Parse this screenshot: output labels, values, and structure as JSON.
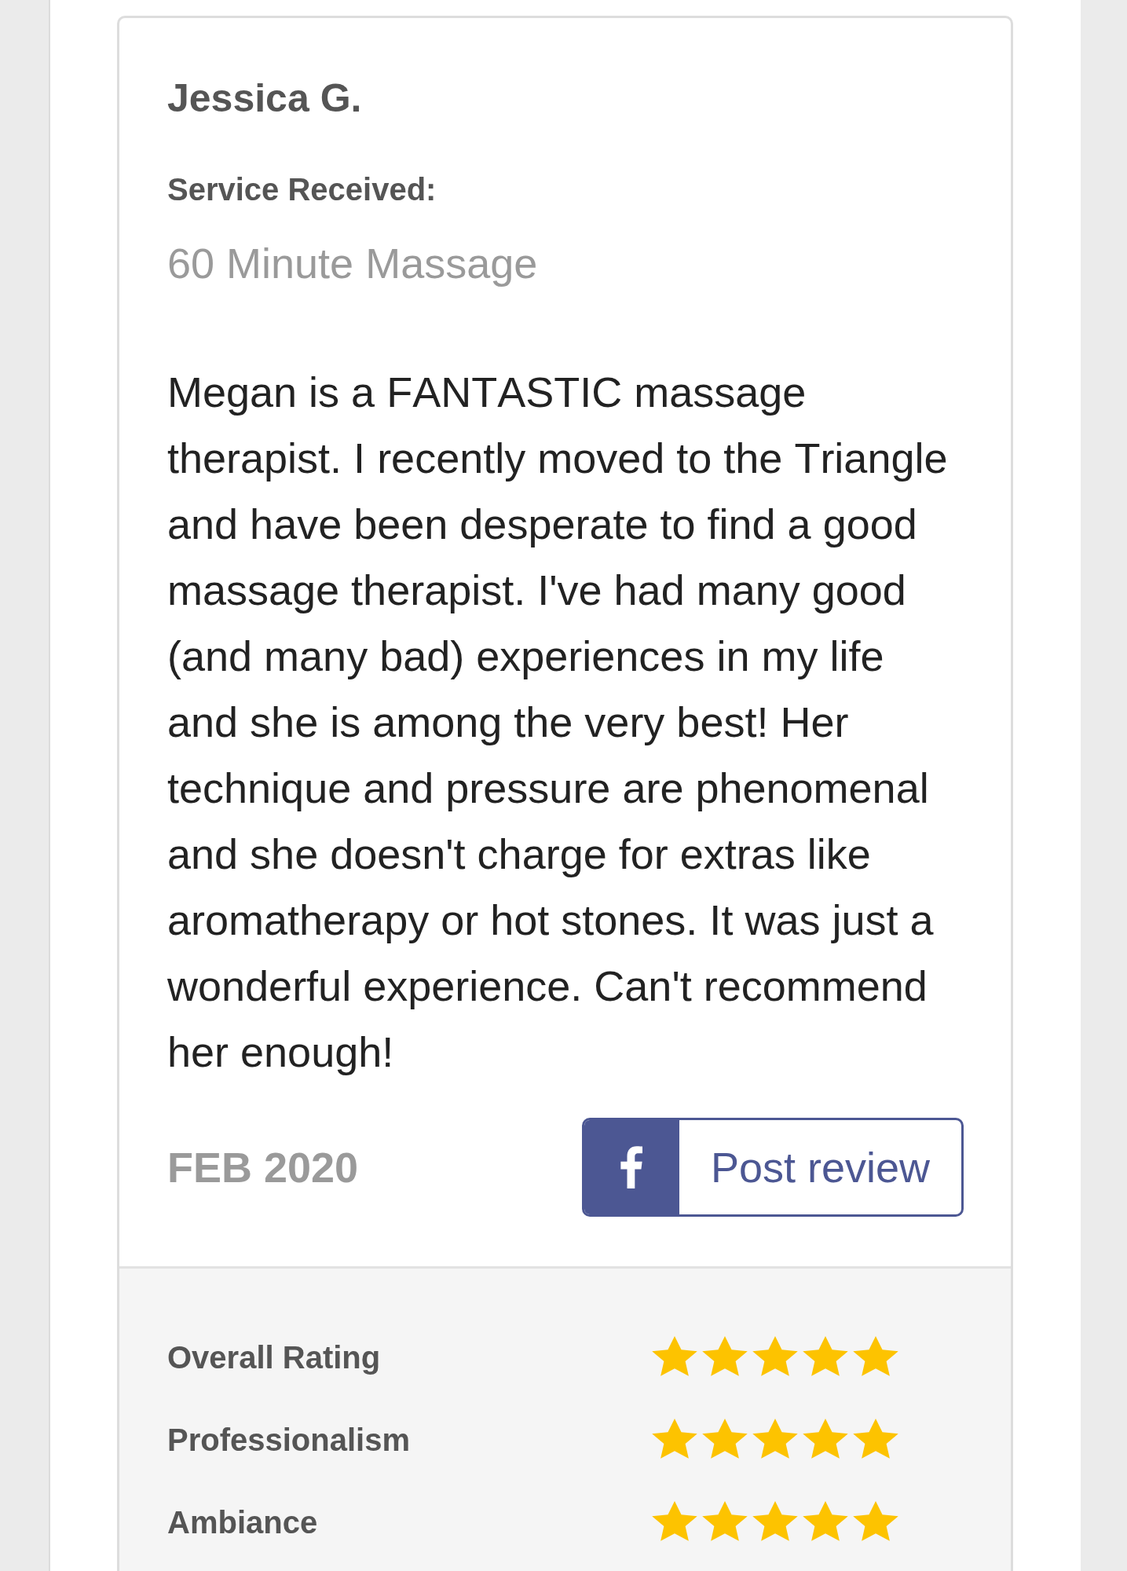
{
  "review": {
    "reviewer": "Jessica G.",
    "service_label": "Service Received:",
    "service": "60 Minute Massage",
    "text": "Megan is a FANTASTIC massage therapist. I recently moved to the Triangle and have been desperate to find a good massage therapist. I've had many good (and many bad) experiences in my life and she is among the very best! Her technique and pressure are phenomenal and she doesn't charge for extras like aromatherapy or hot stones. It was just a wonderful experience. Can't recommend her enough!",
    "date": "FEB 2020",
    "share_button": {
      "label": "Post review"
    }
  },
  "ratings": [
    {
      "label": "Overall Rating",
      "stars": 5
    },
    {
      "label": "Professionalism",
      "stars": 5
    },
    {
      "label": "Ambiance",
      "stars": 5
    }
  ]
}
